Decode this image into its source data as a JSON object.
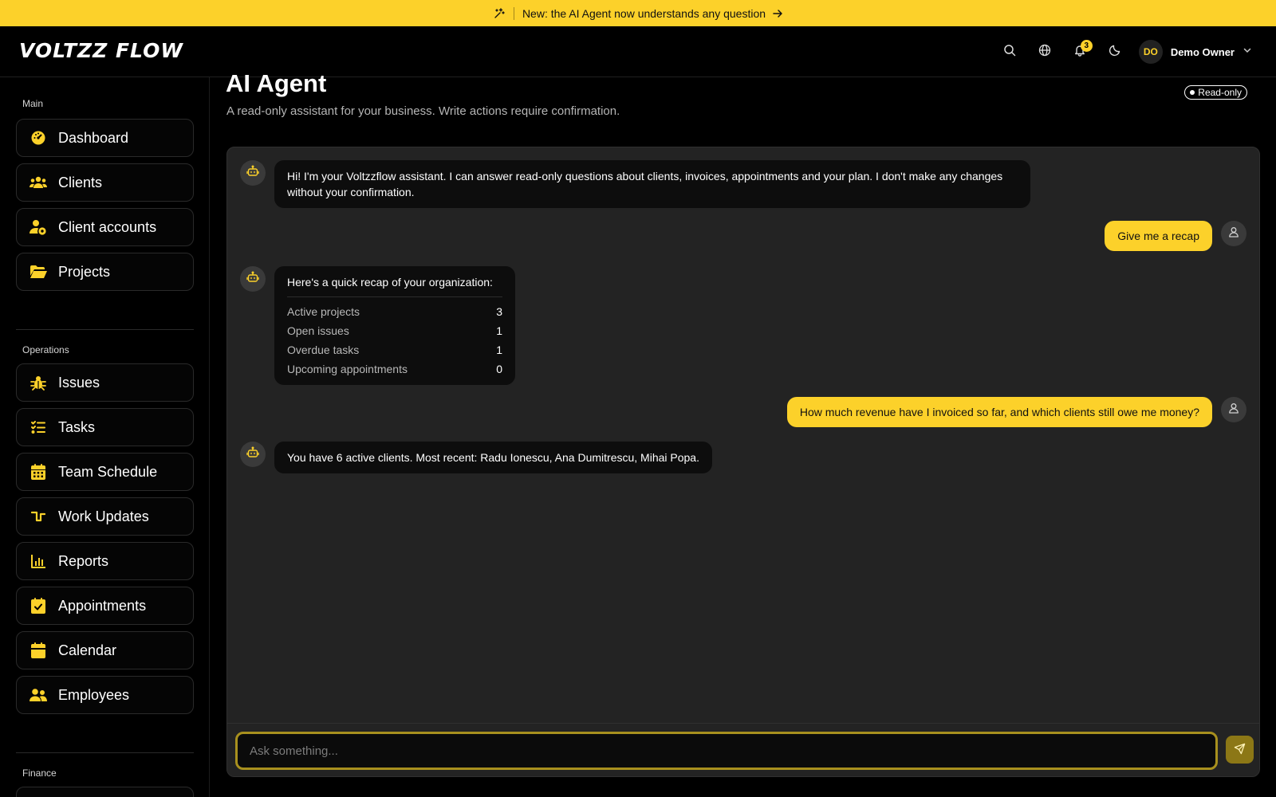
{
  "banner": {
    "text": "New: the AI Agent now understands any question"
  },
  "header": {
    "logo_text": "VOLTZZ FLOW",
    "notifications_count": "3",
    "user_initials": "DO",
    "user_name": "Demo Owner"
  },
  "sidebar": {
    "sections": [
      {
        "title": "Main",
        "items": [
          {
            "label": "Dashboard",
            "icon": "gauge-icon"
          },
          {
            "label": "Clients",
            "icon": "users-icon"
          },
          {
            "label": "Client accounts",
            "icon": "user-gear-icon"
          },
          {
            "label": "Projects",
            "icon": "folder-open-icon"
          }
        ]
      },
      {
        "title": "Operations",
        "items": [
          {
            "label": "Issues",
            "icon": "bug-icon"
          },
          {
            "label": "Tasks",
            "icon": "list-check-icon"
          },
          {
            "label": "Team Schedule",
            "icon": "calendar-grid-icon"
          },
          {
            "label": "Work Updates",
            "icon": "timeline-icon"
          },
          {
            "label": "Reports",
            "icon": "bar-chart-icon"
          },
          {
            "label": "Appointments",
            "icon": "calendar-check-icon"
          },
          {
            "label": "Calendar",
            "icon": "calendar-icon"
          },
          {
            "label": "Employees",
            "icon": "people-icon"
          }
        ]
      },
      {
        "title": "Finance",
        "items": []
      }
    ]
  },
  "page": {
    "title": "AI Agent",
    "subtitle": "A read-only assistant for your business. Write actions require confirmation.",
    "badge": "Read-only"
  },
  "chat": {
    "messages": [
      {
        "role": "bot",
        "text": "Hi! I'm your Voltzzflow assistant. I can answer read-only questions about clients, invoices, appointments and your plan. I don't make any changes without your confirmation."
      },
      {
        "role": "user",
        "text": "Give me a recap"
      },
      {
        "role": "bot",
        "text": "Here's a quick recap of your organization:",
        "rows": [
          {
            "label": "Active projects",
            "value": "3"
          },
          {
            "label": "Open issues",
            "value": "1"
          },
          {
            "label": "Overdue tasks",
            "value": "1"
          },
          {
            "label": "Upcoming appointments",
            "value": "0"
          }
        ]
      },
      {
        "role": "user",
        "text": "How much revenue have I invoiced so far, and which clients still owe me money?"
      },
      {
        "role": "bot",
        "text": "You have 6 active clients. Most recent: Radu Ionescu, Ana Dumitrescu, Mihai Popa."
      }
    ],
    "input_placeholder": "Ask something..."
  },
  "colors": {
    "accent": "#fcd12a",
    "background": "#000000",
    "panel": "#232323"
  }
}
